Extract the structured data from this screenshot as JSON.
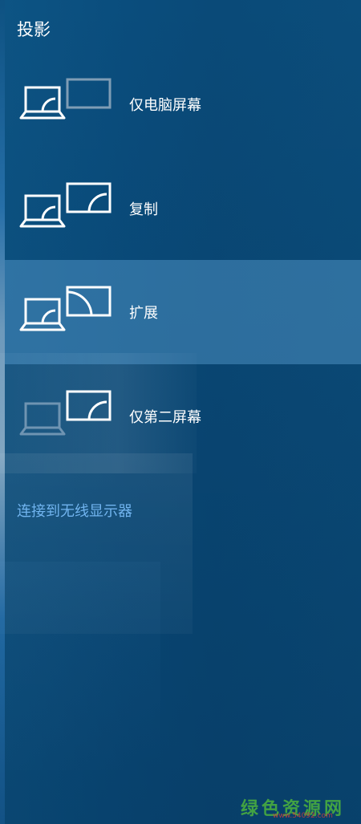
{
  "panel": {
    "title": "投影",
    "options": [
      {
        "label": "仅电脑屏幕",
        "icon": "pc-screen-only-icon",
        "selected": false
      },
      {
        "label": "复制",
        "icon": "duplicate-icon",
        "selected": false
      },
      {
        "label": "扩展",
        "icon": "extend-icon",
        "selected": true
      },
      {
        "label": "仅第二屏幕",
        "icon": "second-screen-only-icon",
        "selected": false
      }
    ],
    "connect_link": "连接到无线显示器"
  },
  "watermark": {
    "main": "绿色资源网",
    "sub": "www.54092.com"
  },
  "colors": {
    "panel_bg": "#0a4d7d",
    "selected_bg": "#3f86bd",
    "link": "#71b4ef",
    "text": "#ffffff"
  }
}
